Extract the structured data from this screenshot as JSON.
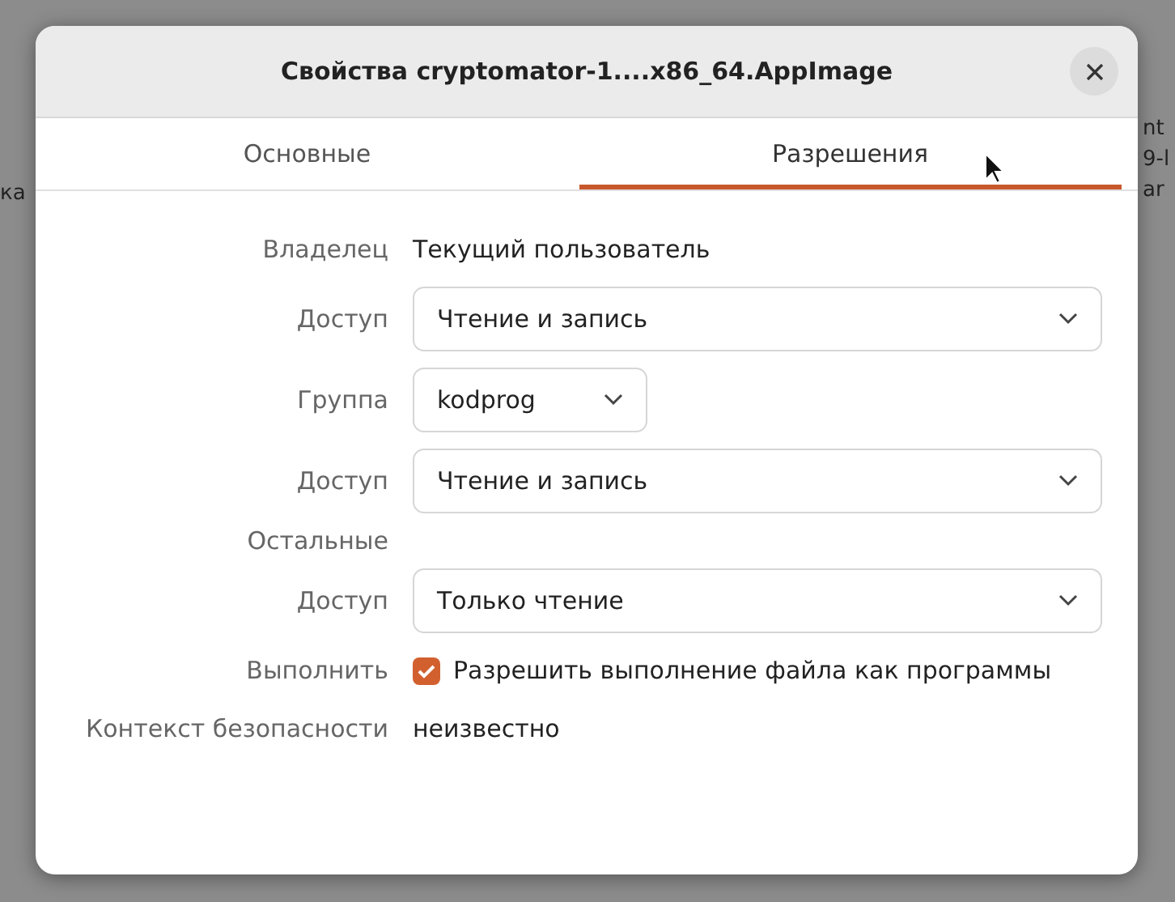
{
  "background": {
    "left_texts": [
      "ка"
    ],
    "right_texts": [
      "nt",
      "9-l",
      "ar"
    ]
  },
  "window": {
    "title": "Свойства cryptomator-1....x86_64.AppImage"
  },
  "tabs": [
    {
      "label": "Основные",
      "selected": false
    },
    {
      "label": "Разрешения",
      "selected": true
    }
  ],
  "rows": [
    {
      "kind": "text",
      "label": "Владелец",
      "value": "Текущий пользователь"
    },
    {
      "kind": "dropdown",
      "label": "Доступ",
      "value": "Чтение и запись",
      "wide": true
    },
    {
      "kind": "dropdown",
      "label": "Группа",
      "value": "kodprog",
      "wide": false
    },
    {
      "kind": "dropdown",
      "label": "Доступ",
      "value": "Чтение и запись",
      "wide": true
    },
    {
      "kind": "heading",
      "label": "Остальные"
    },
    {
      "kind": "dropdown",
      "label": "Доступ",
      "value": "Только чтение",
      "wide": true
    },
    {
      "kind": "checkbox",
      "label": "Выполнить",
      "value": "Разрешить выполнение файла как программы",
      "checked": true
    },
    {
      "kind": "text",
      "label": "Контекст безопасности",
      "value": "неизвестно"
    }
  ]
}
